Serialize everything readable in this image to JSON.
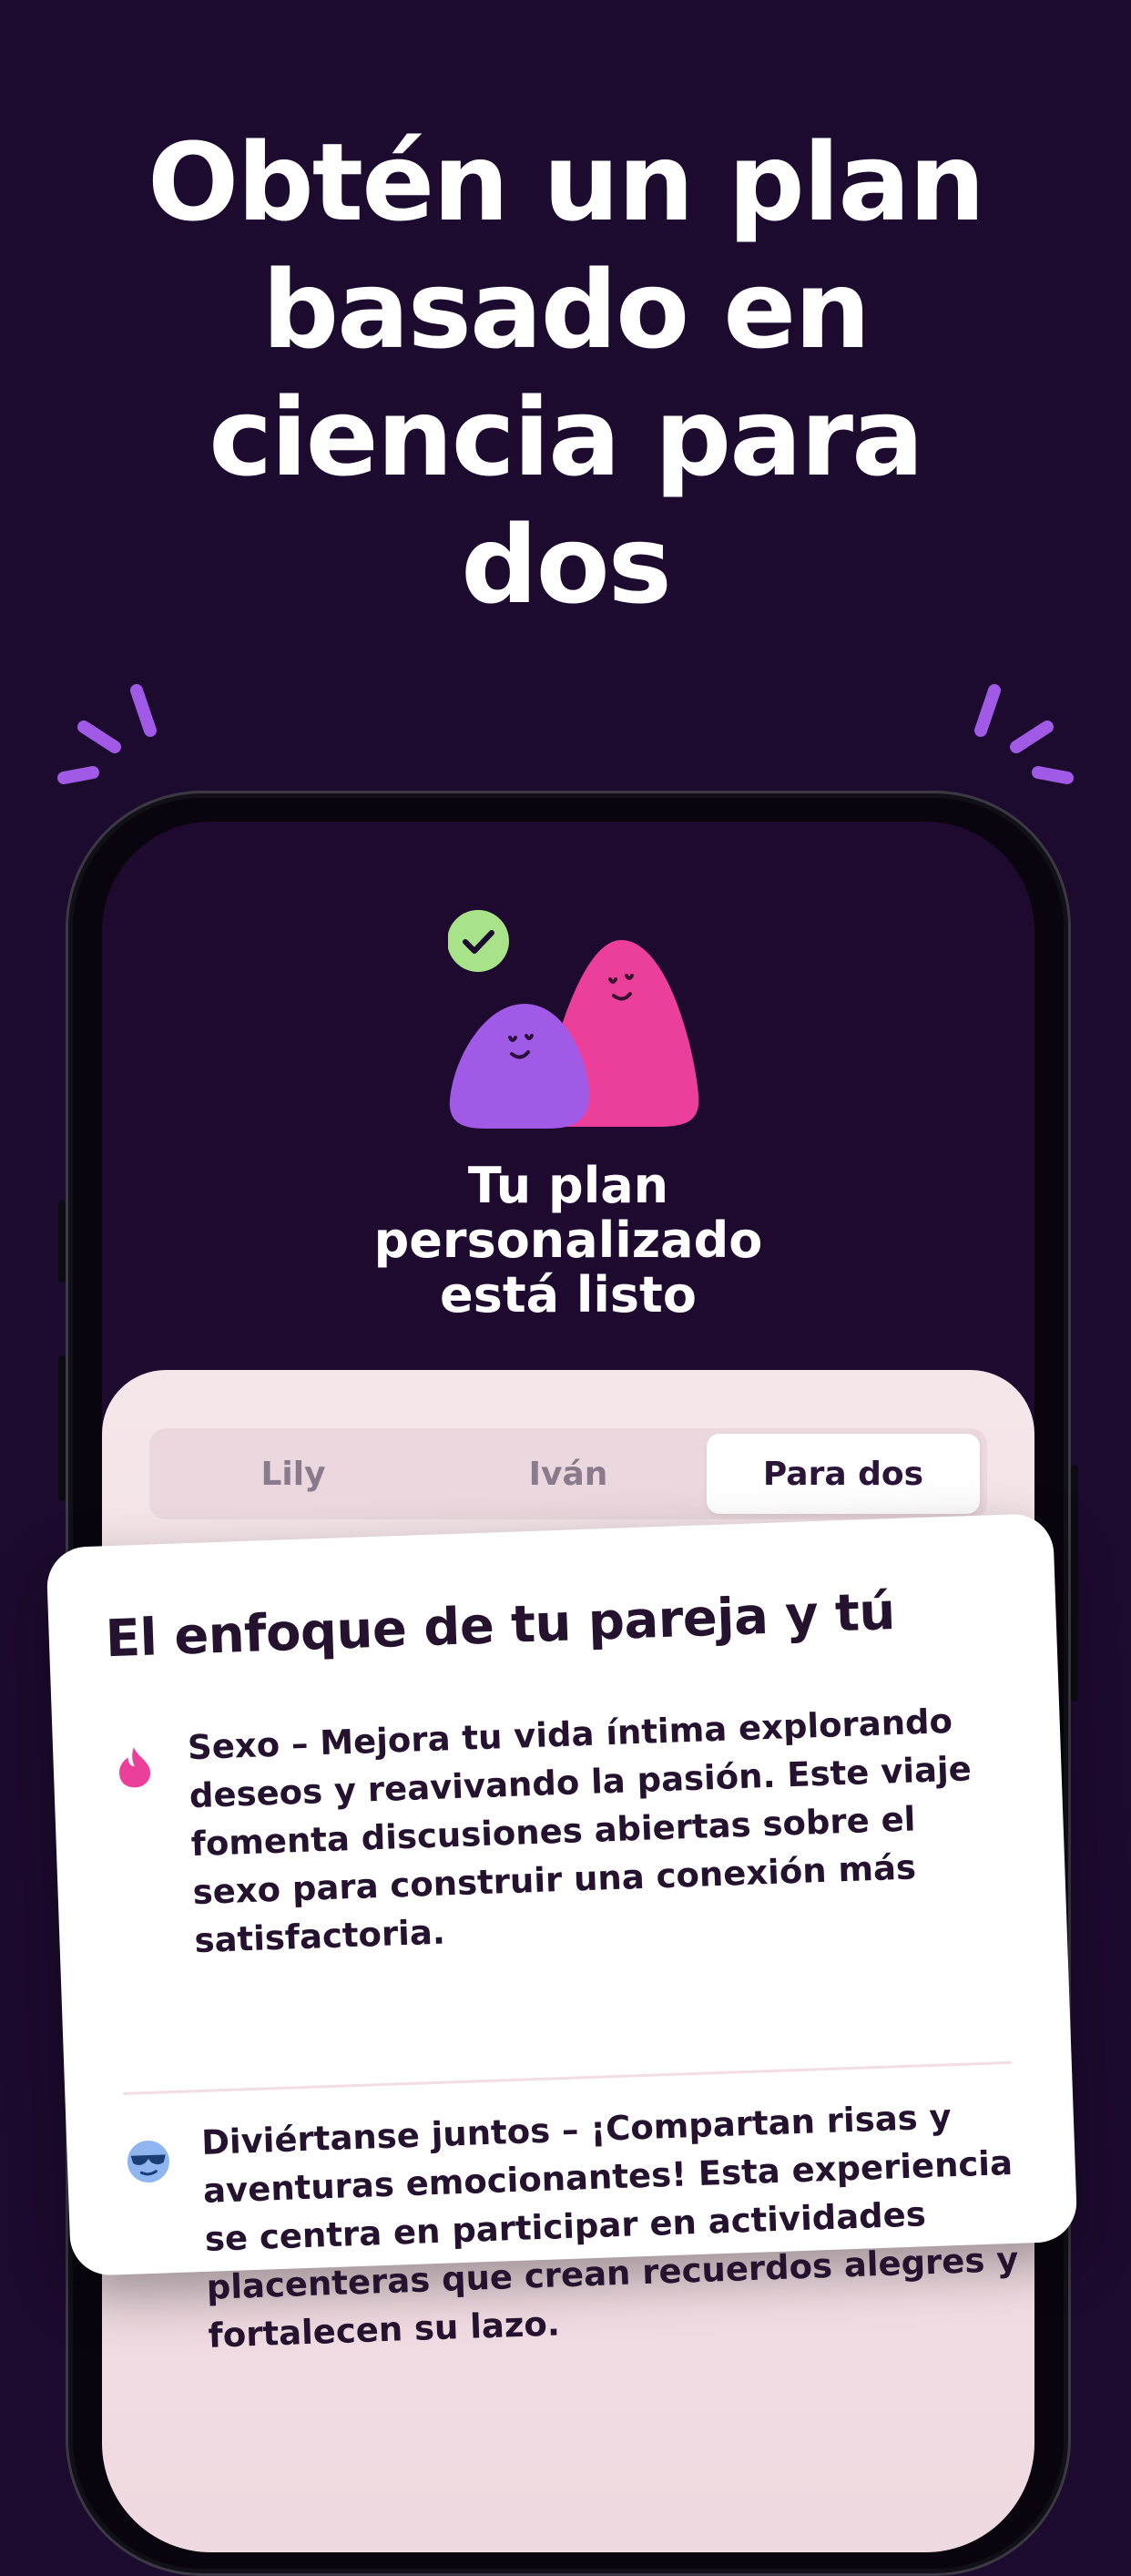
{
  "headline": {
    "line1": "Obtén un plan",
    "line2": "basado en",
    "line3": "ciencia para",
    "line4": "dos"
  },
  "plan": {
    "title_line1": "Tu plan",
    "title_line2": "personalizado",
    "title_line3": "está listo"
  },
  "tabs": [
    {
      "label": "Lily",
      "active": false
    },
    {
      "label": "Iván",
      "active": false
    },
    {
      "label": "Para dos",
      "active": true
    }
  ],
  "card": {
    "title": "El enfoque de tu pareja y tú",
    "items": [
      {
        "icon": "flame-icon",
        "text": "Sexo – Mejora tu vida íntima explorando deseos y reavivando la pasión. Este viaje fomenta discusiones abiertas sobre el sexo para construir una conexión más satisfactoria."
      },
      {
        "icon": "cool-face-icon",
        "text": "Diviértanse juntos – ¡Compartan risas y aventuras emocionantes! Esta experiencia se centra en participar en actividades placenteras que crean recuerdos alegres y fortalecen su lazo."
      }
    ]
  },
  "colors": {
    "background": "#1d0a2f",
    "accent_purple": "#a05ae6",
    "accent_pink": "#ec3f9a",
    "check_green": "#a8e38a",
    "sheet": "#f5e6ea"
  }
}
